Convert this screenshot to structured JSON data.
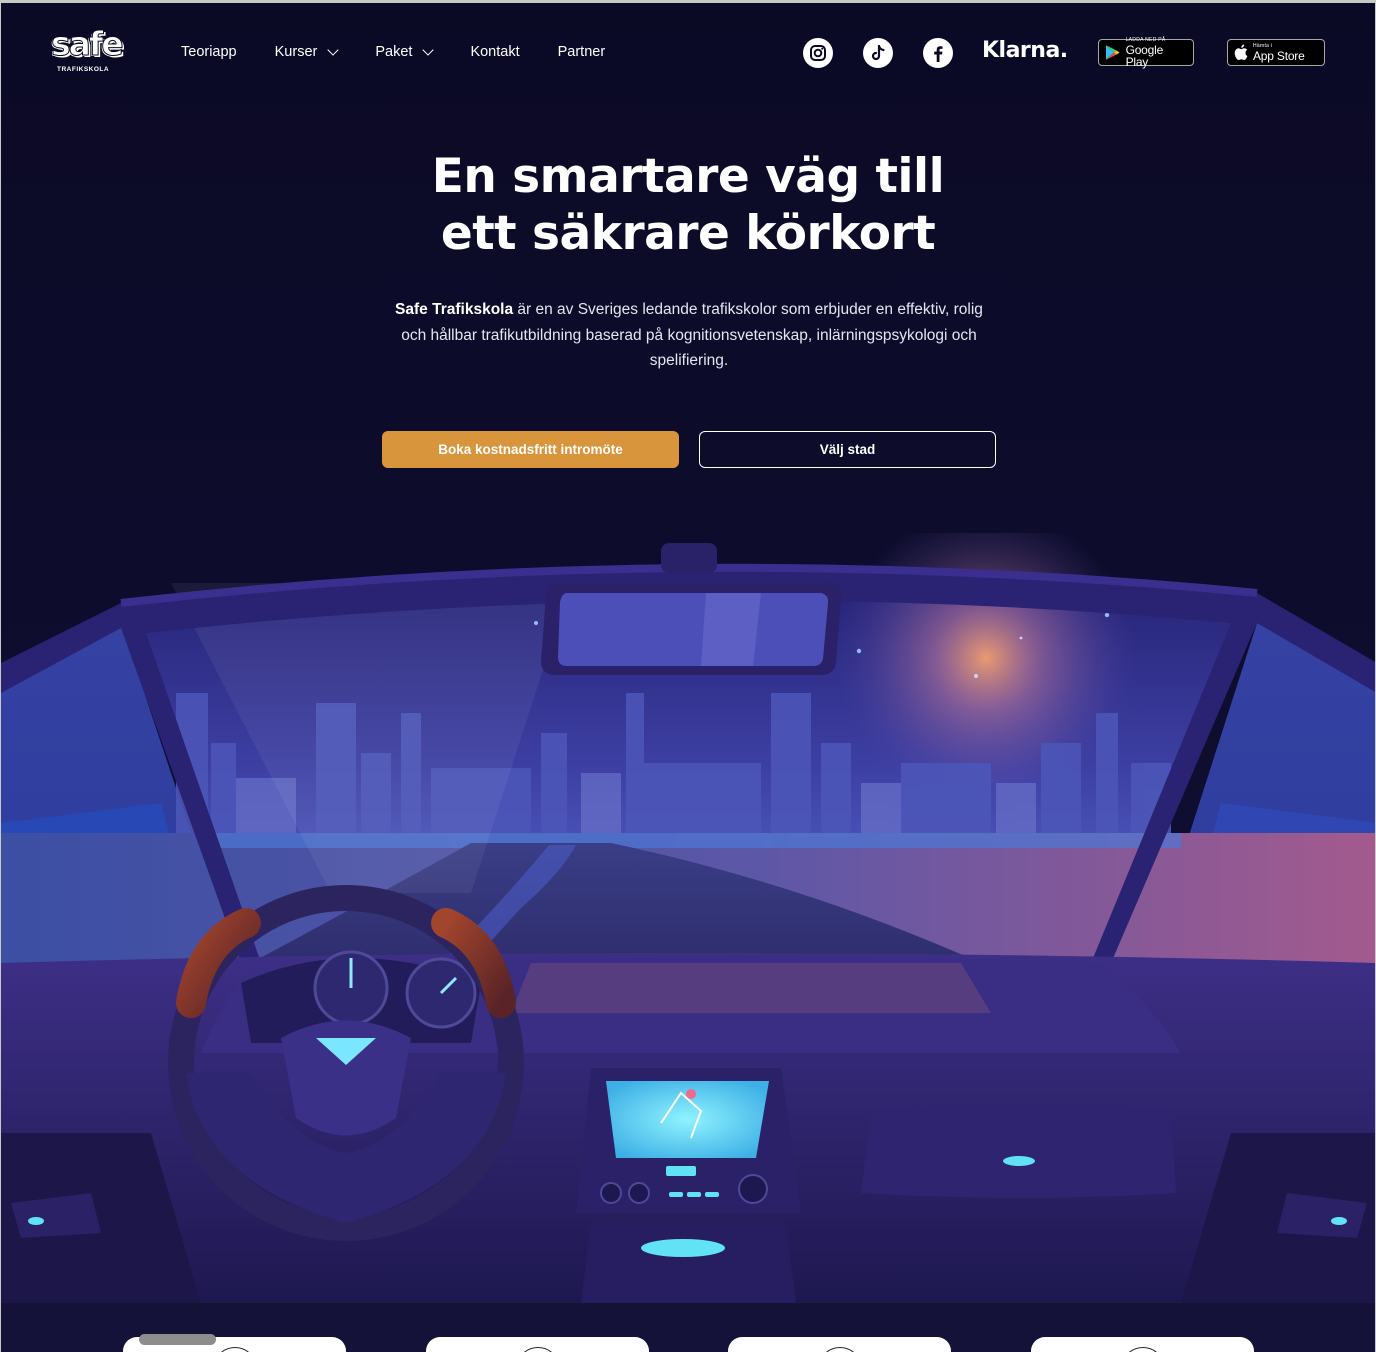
{
  "brand": {
    "logo_word": "safe",
    "logo_sub": "TRAFIKSKOLA"
  },
  "nav": {
    "links": [
      {
        "label": "Teoriapp",
        "dropdown": false
      },
      {
        "label": "Kurser",
        "dropdown": true
      },
      {
        "label": "Paket",
        "dropdown": true
      },
      {
        "label": "Kontakt",
        "dropdown": false
      },
      {
        "label": "Partner",
        "dropdown": false
      }
    ],
    "social_icons": [
      "instagram-icon",
      "tiktok-icon",
      "facebook-icon"
    ],
    "klarna_label": "Klarna.",
    "google_play": {
      "small": "LADDA NED PÅ",
      "big": "Google Play"
    },
    "app_store": {
      "small": "Hämta i",
      "big": "App Store"
    }
  },
  "hero": {
    "title_line1": "En smartare väg till",
    "title_line2": "ett säkrare körkort",
    "desc_bold": "Safe Trafikskola",
    "desc_rest": " är en av Sveriges ledande trafikskolor som erbjuder en effektiv, rolig och hållbar trafikutbildning baserad på kognitionsvetenskap, inlärningspsykologi och spelifiering.",
    "primary_button": "Boka kostnadsfritt intromöte",
    "secondary_button": "Välj stad"
  },
  "colors": {
    "background": "#0b0a25",
    "accent": "#d9953c",
    "car_interior": "#2b2163",
    "screen_glow": "#62e3f5"
  },
  "cards_count": 4
}
